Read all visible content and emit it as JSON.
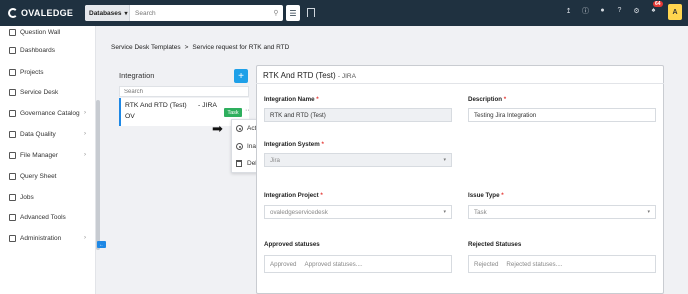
{
  "topbar": {
    "logo_text": "OVALEDGE",
    "db_select": "Databases",
    "search_placeholder": "Search",
    "notif_count": "64",
    "avatar_letter": "A"
  },
  "sidebar": {
    "items": [
      {
        "label": "Question Wall",
        "arrow": false
      },
      {
        "label": "Dashboards",
        "arrow": false
      },
      {
        "label": "Projects",
        "arrow": false
      },
      {
        "label": "Service Desk",
        "arrow": false
      },
      {
        "label": "Governance Catalog",
        "arrow": true
      },
      {
        "label": "Data Quality",
        "arrow": true
      },
      {
        "label": "File Manager",
        "arrow": true
      },
      {
        "label": "Query Sheet",
        "arrow": false
      },
      {
        "label": "Jobs",
        "arrow": false
      },
      {
        "label": "Advanced Tools",
        "arrow": false
      },
      {
        "label": "Administration",
        "arrow": true
      }
    ]
  },
  "breadcrumb": {
    "parent": "Service Desk Templates",
    "separator": ">",
    "current": "Service request for RTK and RTD"
  },
  "integration_list": {
    "title": "Integration",
    "search_placeholder": "Search",
    "item": {
      "name": "RTK And RTD (Test)",
      "system": "- JIRA",
      "org": "OV",
      "badge": "Task"
    }
  },
  "context_menu": {
    "items": [
      "Active",
      "Inactive",
      "Delete"
    ]
  },
  "detail": {
    "title": "RTK And RTD (Test)",
    "system": "- JIRA",
    "integration_name_label": "Integration Name",
    "integration_name_value": "RTK and RTD (Test)",
    "description_label": "Description",
    "description_value": "Testing Jira Integration",
    "integration_system_label": "Integration System",
    "integration_system_value": "Jira",
    "integration_project_label": "Integration Project",
    "integration_project_value": "ovaledgeservicedesk",
    "issue_type_label": "Issue Type",
    "issue_type_value": "Task",
    "approved_label": "Approved statuses",
    "approved_prefix": "Approved",
    "approved_placeholder": "Approved statuses....",
    "rejected_label": "Rejected Statuses",
    "rejected_prefix": "Rejected",
    "rejected_placeholder": "Rejected statuses...."
  },
  "colors": {
    "topbar": "#1f3140",
    "accent": "#1ea0e8",
    "badge_green": "#2eaf5e",
    "required": "#e53935"
  }
}
